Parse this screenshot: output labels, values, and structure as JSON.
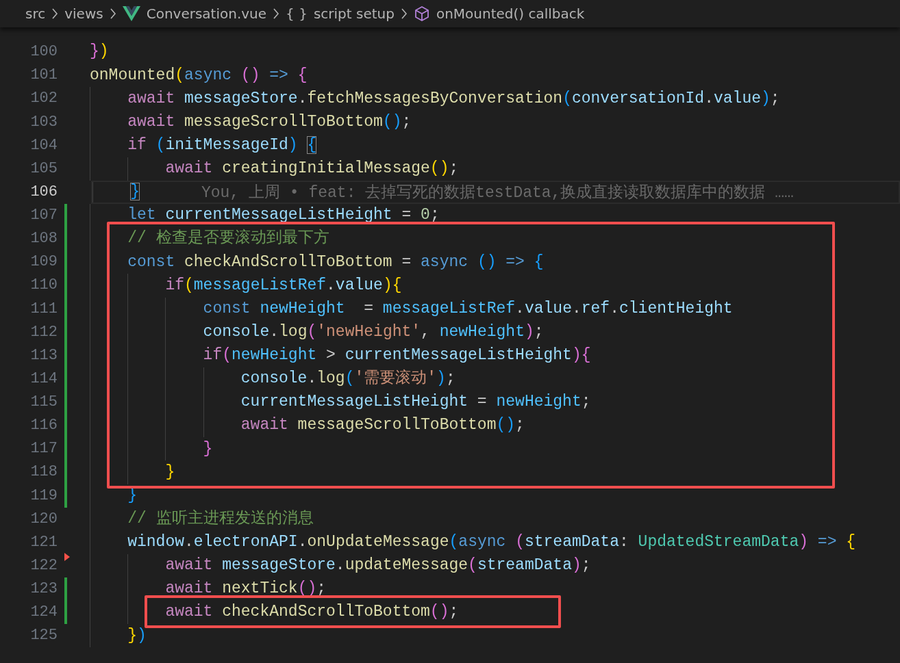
{
  "breadcrumb": [
    {
      "kind": "folder",
      "label": "src"
    },
    {
      "kind": "folder",
      "label": "views"
    },
    {
      "kind": "vue",
      "label": "Conversation.vue"
    },
    {
      "kind": "braces",
      "icon": "{ }",
      "label": "script setup"
    },
    {
      "kind": "method",
      "label": "onMounted() callback"
    }
  ],
  "lines": [
    {
      "number": "100",
      "added": false,
      "deleted": false,
      "current": false,
      "framed": false,
      "tokens": [
        {
          "kind": "o",
          "text": "}"
        },
        {
          "kind": "y",
          "text": ")"
        }
      ]
    },
    {
      "number": "101",
      "added": false,
      "deleted": false,
      "current": false,
      "framed": false,
      "tokens": [
        {
          "kind": "f",
          "text": "onMounted"
        },
        {
          "kind": "y",
          "text": "("
        },
        {
          "kind": "k",
          "text": "async"
        },
        {
          "kind": "o",
          "text": " ()"
        },
        {
          "kind": "k",
          "text": " =>"
        },
        {
          "kind": "o",
          "text": " {"
        }
      ]
    },
    {
      "number": "102",
      "added": false,
      "deleted": false,
      "current": false,
      "framed": false,
      "tokens": [
        {
          "kind": "c",
          "text": "    await"
        },
        {
          "kind": "v",
          "text": " messageStore"
        },
        {
          "kind": "p",
          "text": "."
        },
        {
          "kind": "f",
          "text": "fetchMessagesByConversation"
        },
        {
          "kind": "b",
          "text": "("
        },
        {
          "kind": "v",
          "text": "conversationId"
        },
        {
          "kind": "p",
          "text": "."
        },
        {
          "kind": "v",
          "text": "value"
        },
        {
          "kind": "b",
          "text": ")"
        },
        {
          "kind": "p",
          "text": ";"
        }
      ]
    },
    {
      "number": "103",
      "added": false,
      "deleted": false,
      "current": false,
      "framed": false,
      "tokens": [
        {
          "kind": "c",
          "text": "    await"
        },
        {
          "kind": "f",
          "text": " messageScrollToBottom"
        },
        {
          "kind": "b",
          "text": "()"
        },
        {
          "kind": "p",
          "text": ";"
        }
      ]
    },
    {
      "number": "104",
      "added": false,
      "deleted": false,
      "current": false,
      "framed": false,
      "tokens": [
        {
          "kind": "c",
          "text": "    if"
        },
        {
          "kind": "b",
          "text": " ("
        },
        {
          "kind": "v",
          "text": "initMessageId"
        },
        {
          "kind": "b",
          "text": ")"
        },
        {
          "kind": "x",
          "text": " {"
        }
      ]
    },
    {
      "number": "105",
      "added": false,
      "deleted": false,
      "current": false,
      "framed": false,
      "tokens": [
        {
          "kind": "c",
          "text": "        await"
        },
        {
          "kind": "f",
          "text": " creatingInitialMessage"
        },
        {
          "kind": "y",
          "text": "()"
        },
        {
          "kind": "p",
          "text": ";"
        }
      ]
    },
    {
      "number": "106",
      "added": false,
      "deleted": false,
      "current": true,
      "framed": false,
      "blame": "You, 上周 • feat: 去掉写死的数据testData,换成直接读取数据库中的数据 ……",
      "tokens": [
        {
          "kind": "x",
          "text": "    }"
        }
      ]
    },
    {
      "number": "107",
      "added": true,
      "deleted": false,
      "current": false,
      "framed": false,
      "tokens": [
        {
          "kind": "k",
          "text": "    let"
        },
        {
          "kind": "v",
          "text": " currentMessageListHeight"
        },
        {
          "kind": "p",
          "text": " ="
        },
        {
          "kind": "d",
          "text": " 0"
        },
        {
          "kind": "p",
          "text": ";"
        }
      ]
    },
    {
      "number": "108",
      "added": true,
      "deleted": false,
      "current": false,
      "framed": true,
      "tokens": [
        {
          "kind": "m",
          "text": "    // 检查是否要滚动到最下方"
        }
      ]
    },
    {
      "number": "109",
      "added": true,
      "deleted": false,
      "current": false,
      "framed": true,
      "tokens": [
        {
          "kind": "k",
          "text": "    const"
        },
        {
          "kind": "f",
          "text": " checkAndScrollToBottom"
        },
        {
          "kind": "p",
          "text": " ="
        },
        {
          "kind": "k",
          "text": " async"
        },
        {
          "kind": "b",
          "text": " ()"
        },
        {
          "kind": "k",
          "text": " =>"
        },
        {
          "kind": "b",
          "text": " {"
        }
      ]
    },
    {
      "number": "110",
      "added": true,
      "deleted": false,
      "current": false,
      "framed": true,
      "tokens": [
        {
          "kind": "c",
          "text": "        if"
        },
        {
          "kind": "y",
          "text": "("
        },
        {
          "kind": "n",
          "text": "messageListRef"
        },
        {
          "kind": "p",
          "text": "."
        },
        {
          "kind": "v",
          "text": "value"
        },
        {
          "kind": "y",
          "text": "){"
        }
      ]
    },
    {
      "number": "111",
      "added": true,
      "deleted": false,
      "current": false,
      "framed": true,
      "tokens": [
        {
          "kind": "k",
          "text": "            const"
        },
        {
          "kind": "n",
          "text": " newHeight"
        },
        {
          "kind": "p",
          "text": "  ="
        },
        {
          "kind": "n",
          "text": " messageListRef"
        },
        {
          "kind": "p",
          "text": "."
        },
        {
          "kind": "v",
          "text": "value"
        },
        {
          "kind": "p",
          "text": "."
        },
        {
          "kind": "v",
          "text": "ref"
        },
        {
          "kind": "p",
          "text": "."
        },
        {
          "kind": "v",
          "text": "clientHeight"
        }
      ]
    },
    {
      "number": "112",
      "added": true,
      "deleted": false,
      "current": false,
      "framed": true,
      "tokens": [
        {
          "kind": "v",
          "text": "            console"
        },
        {
          "kind": "p",
          "text": "."
        },
        {
          "kind": "f",
          "text": "log"
        },
        {
          "kind": "o",
          "text": "("
        },
        {
          "kind": "s",
          "text": "'newHeight'"
        },
        {
          "kind": "p",
          "text": ","
        },
        {
          "kind": "n",
          "text": " newHeight"
        },
        {
          "kind": "o",
          "text": ")"
        },
        {
          "kind": "p",
          "text": ";"
        }
      ]
    },
    {
      "number": "113",
      "added": true,
      "deleted": false,
      "current": false,
      "framed": true,
      "tokens": [
        {
          "kind": "c",
          "text": "            if"
        },
        {
          "kind": "o",
          "text": "("
        },
        {
          "kind": "n",
          "text": "newHeight"
        },
        {
          "kind": "p",
          "text": " >"
        },
        {
          "kind": "v",
          "text": " currentMessageListHeight"
        },
        {
          "kind": "o",
          "text": "){"
        }
      ]
    },
    {
      "number": "114",
      "added": true,
      "deleted": false,
      "current": false,
      "framed": true,
      "tokens": [
        {
          "kind": "v",
          "text": "                console"
        },
        {
          "kind": "p",
          "text": "."
        },
        {
          "kind": "f",
          "text": "log"
        },
        {
          "kind": "b",
          "text": "("
        },
        {
          "kind": "s",
          "text": "'需要滚动'"
        },
        {
          "kind": "b",
          "text": ")"
        },
        {
          "kind": "p",
          "text": ";"
        }
      ]
    },
    {
      "number": "115",
      "added": true,
      "deleted": false,
      "current": false,
      "framed": true,
      "tokens": [
        {
          "kind": "v",
          "text": "                currentMessageListHeight"
        },
        {
          "kind": "p",
          "text": " ="
        },
        {
          "kind": "n",
          "text": " newHeight"
        },
        {
          "kind": "p",
          "text": ";"
        }
      ]
    },
    {
      "number": "116",
      "added": true,
      "deleted": false,
      "current": false,
      "framed": true,
      "tokens": [
        {
          "kind": "c",
          "text": "                await"
        },
        {
          "kind": "f",
          "text": " messageScrollToBottom"
        },
        {
          "kind": "b",
          "text": "()"
        },
        {
          "kind": "p",
          "text": ";"
        }
      ]
    },
    {
      "number": "117",
      "added": true,
      "deleted": false,
      "current": false,
      "framed": true,
      "tokens": [
        {
          "kind": "o",
          "text": "            }"
        }
      ]
    },
    {
      "number": "118",
      "added": true,
      "deleted": false,
      "current": false,
      "framed": true,
      "tokens": [
        {
          "kind": "y",
          "text": "        }"
        }
      ]
    },
    {
      "number": "119",
      "added": true,
      "deleted": false,
      "current": false,
      "framed": false,
      "tokens": [
        {
          "kind": "b",
          "text": "    }"
        }
      ]
    },
    {
      "number": "120",
      "added": false,
      "deleted": false,
      "current": false,
      "framed": false,
      "tokens": [
        {
          "kind": "m",
          "text": "    // 监听主进程发送的消息"
        }
      ]
    },
    {
      "number": "121",
      "added": false,
      "deleted": false,
      "current": false,
      "framed": false,
      "tokens": [
        {
          "kind": "v",
          "text": "    window"
        },
        {
          "kind": "p",
          "text": "."
        },
        {
          "kind": "v",
          "text": "electronAPI"
        },
        {
          "kind": "p",
          "text": "."
        },
        {
          "kind": "f",
          "text": "onUpdateMessage"
        },
        {
          "kind": "b",
          "text": "("
        },
        {
          "kind": "k",
          "text": "async"
        },
        {
          "kind": "o",
          "text": " ("
        },
        {
          "kind": "v",
          "text": "streamData"
        },
        {
          "kind": "p",
          "text": ":"
        },
        {
          "kind": "t",
          "text": " UpdatedStreamData"
        },
        {
          "kind": "o",
          "text": ")"
        },
        {
          "kind": "k",
          "text": " =>"
        },
        {
          "kind": "y",
          "text": " {"
        }
      ]
    },
    {
      "number": "122",
      "added": false,
      "deleted": true,
      "current": false,
      "framed": false,
      "tokens": [
        {
          "kind": "c",
          "text": "        await"
        },
        {
          "kind": "v",
          "text": " messageStore"
        },
        {
          "kind": "p",
          "text": "."
        },
        {
          "kind": "f",
          "text": "updateMessage"
        },
        {
          "kind": "o",
          "text": "("
        },
        {
          "kind": "v",
          "text": "streamData"
        },
        {
          "kind": "o",
          "text": ")"
        },
        {
          "kind": "p",
          "text": ";"
        }
      ]
    },
    {
      "number": "123",
      "added": true,
      "deleted": false,
      "current": false,
      "framed": false,
      "tokens": [
        {
          "kind": "c",
          "text": "        await"
        },
        {
          "kind": "f",
          "text": " nextTick"
        },
        {
          "kind": "o",
          "text": "()"
        },
        {
          "kind": "p",
          "text": ";"
        }
      ]
    },
    {
      "number": "124",
      "added": true,
      "deleted": false,
      "current": false,
      "framed": true,
      "tokens": [
        {
          "kind": "c",
          "text": "        await"
        },
        {
          "kind": "f",
          "text": " checkAndScrollToBottom"
        },
        {
          "kind": "o",
          "text": "()"
        },
        {
          "kind": "p",
          "text": ";"
        }
      ]
    },
    {
      "number": "125",
      "added": false,
      "deleted": false,
      "current": false,
      "framed": false,
      "tokens": [
        {
          "kind": "y",
          "text": "    }"
        },
        {
          "kind": "b",
          "text": ")"
        }
      ]
    }
  ]
}
